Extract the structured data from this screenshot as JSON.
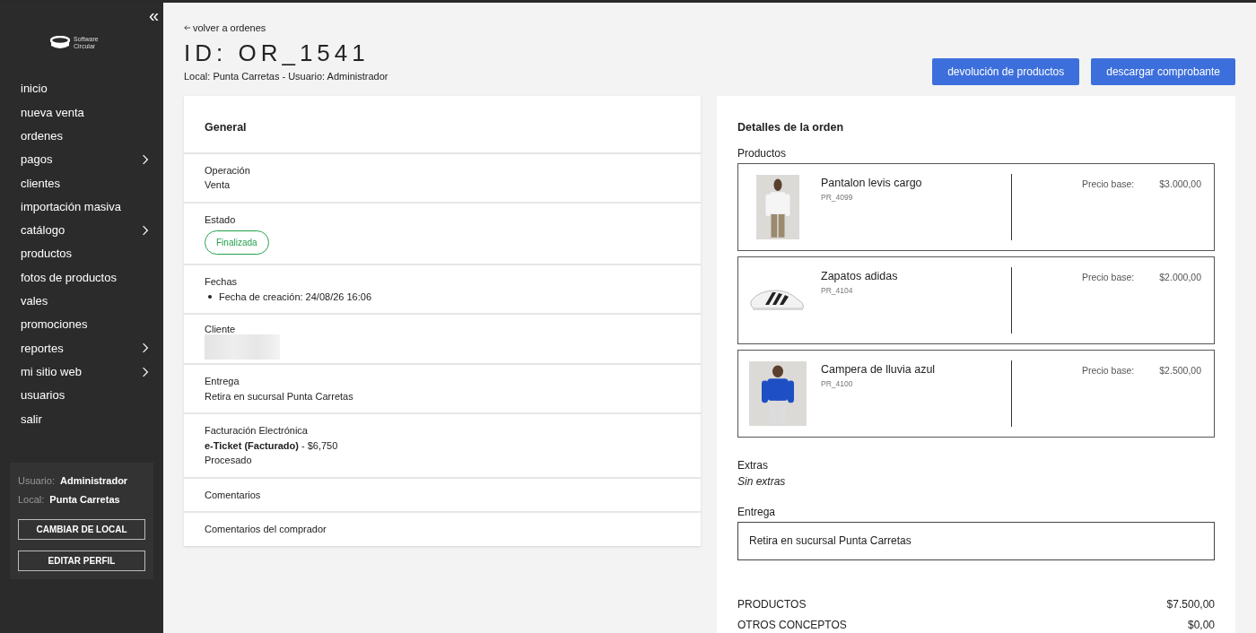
{
  "sidebar": {
    "collapse_icon": "«",
    "logo_lines": [
      "Software",
      "Circular"
    ],
    "items": [
      {
        "label": "inicio",
        "has_submenu": false
      },
      {
        "label": "nueva venta",
        "has_submenu": false
      },
      {
        "label": "ordenes",
        "has_submenu": false
      },
      {
        "label": "pagos",
        "has_submenu": true
      },
      {
        "label": "clientes",
        "has_submenu": false
      },
      {
        "label": "importación masiva",
        "has_submenu": false
      },
      {
        "label": "catálogo",
        "has_submenu": true
      },
      {
        "label": "productos",
        "has_submenu": false
      },
      {
        "label": "fotos de productos",
        "has_submenu": false
      },
      {
        "label": "vales",
        "has_submenu": false
      },
      {
        "label": "promociones",
        "has_submenu": false
      },
      {
        "label": "reportes",
        "has_submenu": true
      },
      {
        "label": "mi sitio web",
        "has_submenu": true
      },
      {
        "label": "usuarios",
        "has_submenu": false
      },
      {
        "label": "salir",
        "has_submenu": false
      }
    ],
    "user_info": [
      {
        "label": "Usuario:",
        "value": "Administrador"
      },
      {
        "label": "Local:",
        "value": "Punta Carretas"
      }
    ],
    "buttons": [
      "CAMBIAR DE LOCAL",
      "EDITAR PERFIL"
    ]
  },
  "header": {
    "back_link": "volver a ordenes",
    "title": "ID: OR_1541",
    "subtitle": "Local: Punta Carretas - Usuario: Administrador",
    "actions": [
      "devolución de productos",
      "descargar comprobante"
    ]
  },
  "general": {
    "title": "General",
    "sections": [
      {
        "kind": "text",
        "label": "Operación",
        "lines": [
          "Venta"
        ]
      },
      {
        "kind": "badge",
        "label": "Estado",
        "badge": "Finalizada",
        "color": "#22a04b"
      },
      {
        "kind": "bullets",
        "label": "Fechas",
        "lines": [
          "Fecha de creación: 24/08/26 16:06"
        ]
      },
      {
        "kind": "redacted",
        "label": "Cliente"
      },
      {
        "kind": "text",
        "label": "Entrega",
        "lines": [
          "Retira en sucursal Punta Carretas"
        ]
      },
      {
        "kind": "text",
        "label": "Facturación Electrónica",
        "lines": [
          "**e-Ticket (Facturado)** - $6,750",
          "Procesado"
        ]
      },
      {
        "kind": "text",
        "label": "Comentarios"
      },
      {
        "kind": "text",
        "label": "Comentarios del comprador"
      }
    ]
  },
  "details": {
    "title": "Detalles de la orden",
    "products_label": "Productos",
    "products": [
      {
        "name": "Pantalon levis cargo",
        "code": "PR_4099",
        "price_label": "Precio base:",
        "price": "$3.000,00",
        "kind": "picture"
      },
      {
        "name": "Zapatos adidas",
        "code": "PR_4104",
        "price_label": "Precio base:",
        "price": "$2.000,00",
        "kind": "picture"
      },
      {
        "name": "Campera de lluvia azul",
        "code": "PR_4100",
        "price_label": "Precio base:",
        "price": "$2.500,00",
        "kind": "picture"
      }
    ],
    "extras_label": "Extras",
    "extras_value": "Sin extras",
    "delivery_label": "Entrega",
    "delivery_value": "Retira en sucursal Punta Carretas",
    "totals": [
      {
        "label": "PRODUCTOS",
        "value": "$7.500,00"
      },
      {
        "label": "OTROS CONCEPTOS",
        "value": "$0,00"
      }
    ]
  }
}
